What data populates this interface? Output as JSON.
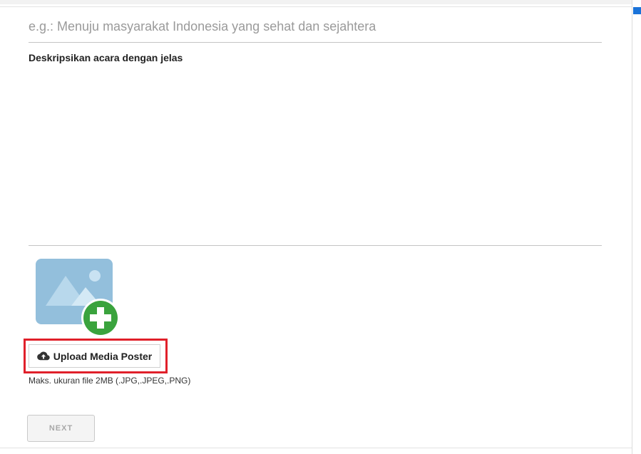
{
  "event_title": {
    "value": "",
    "placeholder": "e.g.: Menuju masyarakat Indonesia yang sehat dan sejahtera"
  },
  "description": {
    "label": "Deskripsikan acara dengan jelas",
    "value": ""
  },
  "poster": {
    "icon": "image-add-icon",
    "upload_label": "Upload Media Poster",
    "upload_icon": "cloud-upload-icon",
    "size_note": "Maks. ukuran file 2MB (.JPG,.JPEG,.PNG)"
  },
  "actions": {
    "next_label": "NEXT"
  },
  "colors": {
    "highlight": "#e0202a",
    "plus_badge": "#3aa33d",
    "image_placeholder": "#93bfdc",
    "scroll_accent": "#1a73d9"
  }
}
